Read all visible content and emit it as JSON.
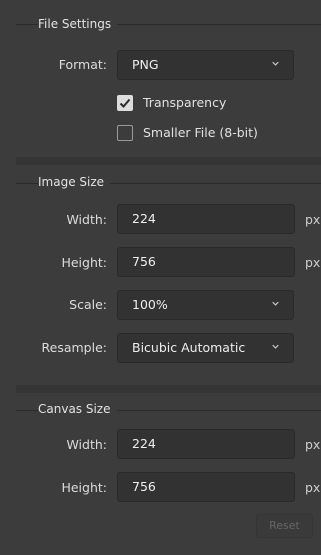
{
  "file_settings": {
    "title": "File Settings",
    "format_label": "Format:",
    "format_value": "PNG",
    "transparency_label": "Transparency",
    "transparency_checked": true,
    "smaller_file_label": "Smaller File (8-bit)",
    "smaller_file_checked": false
  },
  "image_size": {
    "title": "Image Size",
    "width_label": "Width:",
    "width_value": "224",
    "width_unit": "px",
    "height_label": "Height:",
    "height_value": "756",
    "height_unit": "px",
    "scale_label": "Scale:",
    "scale_value": "100%",
    "resample_label": "Resample:",
    "resample_value": "Bicubic Automatic"
  },
  "canvas_size": {
    "title": "Canvas Size",
    "width_label": "Width:",
    "width_value": "224",
    "width_unit": "px",
    "height_label": "Height:",
    "height_value": "756",
    "height_unit": "px",
    "reset_label": "Reset"
  },
  "colors": {
    "background": "#3c3c3c",
    "field": "#323232",
    "text": "#e6e6e6"
  }
}
